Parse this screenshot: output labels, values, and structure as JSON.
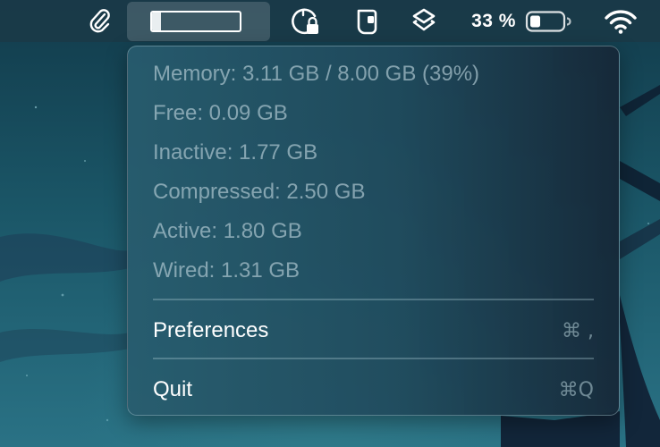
{
  "menubar": {
    "items": [
      {
        "icon": "paperclip-icon"
      },
      {
        "icon": "memory-gauge-icon",
        "fill": 0.1
      },
      {
        "icon": "timer-lock-icon"
      },
      {
        "icon": "wallet-app-icon"
      },
      {
        "icon": "shortcuts-icon"
      },
      {
        "icon": "battery-icon"
      },
      {
        "icon": "wifi-icon"
      }
    ],
    "battery_percent": "33 %"
  },
  "memory_menu": {
    "stats": [
      "Memory: 3.11 GB / 8.00 GB (39%)",
      "Free: 0.09 GB",
      "Inactive: 1.77 GB",
      "Compressed: 2.50 GB",
      "Active: 1.80 GB",
      "Wired: 1.31 GB"
    ],
    "actions": [
      {
        "label": "Preferences",
        "shortcut": "⌘ ,"
      },
      {
        "label": "Quit",
        "shortcut": "⌘Q"
      }
    ]
  },
  "colors": {
    "menubar_bg": "#1a3a48",
    "menu_bg": "#245667",
    "stat_text": "#aac4cd",
    "label_text": "#ffffff",
    "wallpaper": "#1a5566"
  }
}
